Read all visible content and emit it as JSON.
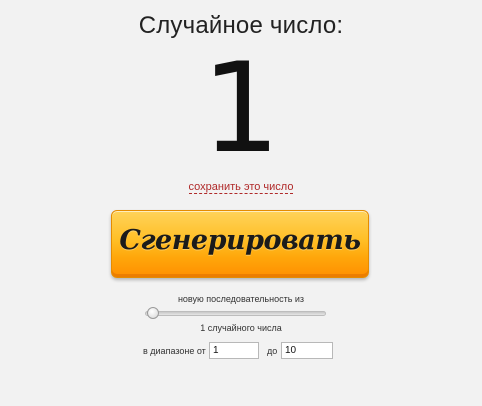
{
  "header": {
    "title": "Случайное число:"
  },
  "result": {
    "value": "1",
    "save_link": "сохранить это число"
  },
  "actions": {
    "generate_label": "Сгенерировать"
  },
  "settings": {
    "sequence_label": "новую последовательность из",
    "slider_value": 1,
    "count_label": "1 случайного числа",
    "range_prefix": "в диапазоне от",
    "range_from": "1",
    "range_to_label": "до",
    "range_to": "10"
  },
  "colors": {
    "button_gradient_top": "#ffd35a",
    "button_gradient_bottom": "#ff8f00",
    "link_color": "#b02a2a",
    "background": "#f2f2f2"
  }
}
